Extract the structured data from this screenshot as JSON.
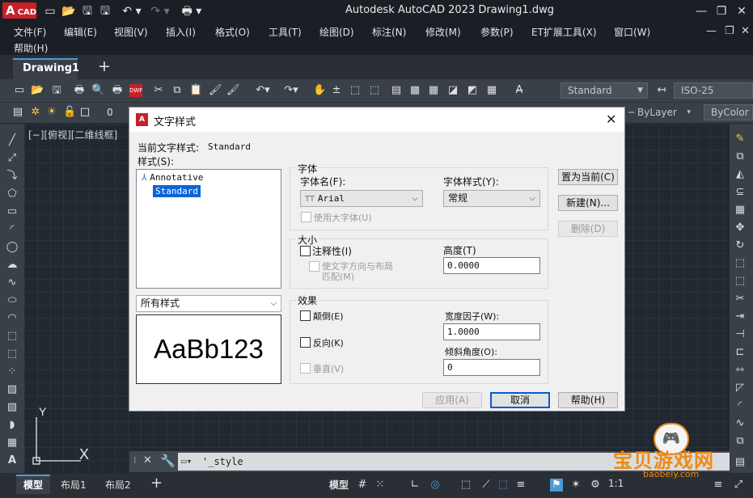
{
  "app": {
    "logo_letter": "A",
    "logo_text": "CAD",
    "title": "Autodesk AutoCAD 2023    Drawing1.dwg"
  },
  "menu": [
    "文件(F)",
    "编辑(E)",
    "视图(V)",
    "插入(I)",
    "格式(O)",
    "工具(T)",
    "绘图(D)",
    "标注(N)",
    "修改(M)",
    "参数(P)",
    "ET扩展工具(X)",
    "窗口(W)",
    "帮助(H)"
  ],
  "tabs": {
    "drawing": "Drawing1",
    "plus": "+"
  },
  "toolbar": {
    "text_style": "Standard",
    "dim_style": "ISO-25",
    "layer_value": "0",
    "color_value": "ByLayer",
    "plot_style": "ByColor"
  },
  "viewport": {
    "label": "[−][俯视][二维线框]"
  },
  "ucs": {
    "y": "Y",
    "x": "X"
  },
  "command": {
    "text": "'_style"
  },
  "status": {
    "model_tab": "模型",
    "layout1": "布局1",
    "layout2": "布局2",
    "model_btn": "模型",
    "scale": "1:1"
  },
  "dialog": {
    "title": "文字样式",
    "current_style_label": "当前文字样式:",
    "current_style_value": "Standard",
    "styles_label": "样式(S):",
    "styles": [
      "Annotative",
      "Standard"
    ],
    "filter": "所有样式",
    "preview": "AaBb123",
    "font_group": "字体",
    "font_name_label": "字体名(F):",
    "font_name": "Arial",
    "font_style_label": "字体样式(Y):",
    "font_style": "常规",
    "bigfont_label": "使用大字体(U)",
    "size_group": "大小",
    "annotative_label": "注释性(I)",
    "match_label_1": "使文字方向与布局",
    "match_label_2": "匹配(M)",
    "height_label": "高度(T)",
    "height_value": "0.0000",
    "effects_group": "效果",
    "upside_down_label": "颠倒(E)",
    "backwards_label": "反向(K)",
    "vertical_label": "垂直(V)",
    "width_factor_label": "宽度因子(W):",
    "width_factor_value": "1.0000",
    "oblique_label": "倾斜角度(O):",
    "oblique_value": "0",
    "btn_set_current": "置为当前(C)",
    "btn_new": "新建(N)...",
    "btn_delete": "删除(D)",
    "btn_apply": "应用(A)",
    "btn_cancel": "取消",
    "btn_help": "帮助(H)"
  },
  "watermark": {
    "text": "宝贝游戏网",
    "url": "baobeiy.com"
  }
}
